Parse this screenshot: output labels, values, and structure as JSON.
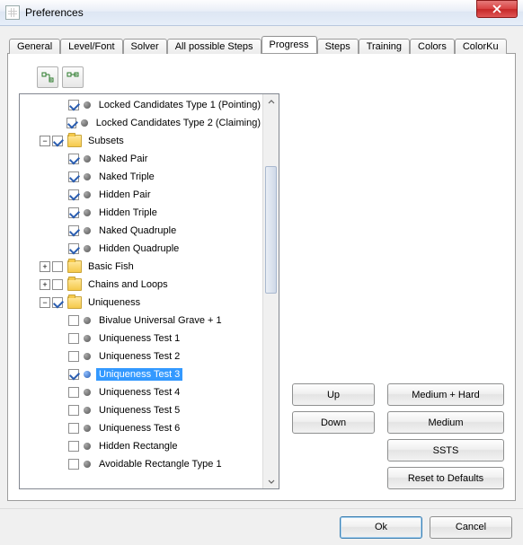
{
  "window": {
    "title": "Preferences"
  },
  "tabs": {
    "items": [
      "General",
      "Level/Font",
      "Solver",
      "All possible Steps",
      "Progress",
      "Steps",
      "Training",
      "Colors",
      "ColorKu"
    ],
    "active_index": 4
  },
  "toolbar": {
    "expand_all_name": "expand-all",
    "collapse_all_name": "collapse-all"
  },
  "tree": {
    "selected_label": "Uniqueness Test 3",
    "rows": [
      {
        "depth": 2,
        "expander": "",
        "checked": true,
        "icon": "bullet",
        "label": "Locked Candidates Type 1 (Pointing)"
      },
      {
        "depth": 2,
        "expander": "",
        "checked": true,
        "icon": "bullet",
        "label": "Locked Candidates Type 2 (Claiming)"
      },
      {
        "depth": 1,
        "expander": "-",
        "checked": true,
        "icon": "folder",
        "label": "Subsets"
      },
      {
        "depth": 2,
        "expander": "",
        "checked": true,
        "icon": "bullet",
        "label": "Naked Pair"
      },
      {
        "depth": 2,
        "expander": "",
        "checked": true,
        "icon": "bullet",
        "label": "Naked Triple"
      },
      {
        "depth": 2,
        "expander": "",
        "checked": true,
        "icon": "bullet",
        "label": "Hidden Pair"
      },
      {
        "depth": 2,
        "expander": "",
        "checked": true,
        "icon": "bullet",
        "label": "Hidden Triple"
      },
      {
        "depth": 2,
        "expander": "",
        "checked": true,
        "icon": "bullet",
        "label": "Naked Quadruple"
      },
      {
        "depth": 2,
        "expander": "",
        "checked": true,
        "icon": "bullet",
        "label": "Hidden Quadruple"
      },
      {
        "depth": 1,
        "expander": "+",
        "checked": false,
        "icon": "folder",
        "label": "Basic Fish"
      },
      {
        "depth": 1,
        "expander": "+",
        "checked": false,
        "icon": "folder",
        "label": "Chains and Loops"
      },
      {
        "depth": 1,
        "expander": "-",
        "checked": true,
        "icon": "folder",
        "label": "Uniqueness"
      },
      {
        "depth": 2,
        "expander": "",
        "checked": false,
        "icon": "bullet",
        "label": "Bivalue Universal Grave + 1"
      },
      {
        "depth": 2,
        "expander": "",
        "checked": false,
        "icon": "bullet",
        "label": "Uniqueness Test 1"
      },
      {
        "depth": 2,
        "expander": "",
        "checked": false,
        "icon": "bullet",
        "label": "Uniqueness Test 2"
      },
      {
        "depth": 2,
        "expander": "",
        "checked": true,
        "icon": "bullet",
        "label": "Uniqueness Test 3",
        "selected": true
      },
      {
        "depth": 2,
        "expander": "",
        "checked": false,
        "icon": "bullet",
        "label": "Uniqueness Test 4"
      },
      {
        "depth": 2,
        "expander": "",
        "checked": false,
        "icon": "bullet",
        "label": "Uniqueness Test 5"
      },
      {
        "depth": 2,
        "expander": "",
        "checked": false,
        "icon": "bullet",
        "label": "Uniqueness Test 6"
      },
      {
        "depth": 2,
        "expander": "",
        "checked": false,
        "icon": "bullet",
        "label": "Hidden Rectangle"
      },
      {
        "depth": 2,
        "expander": "",
        "checked": false,
        "icon": "bullet",
        "label": "Avoidable Rectangle Type 1"
      }
    ]
  },
  "buttons": {
    "up": "Up",
    "down": "Down",
    "medium_hard": "Medium + Hard",
    "medium": "Medium",
    "ssts": "SSTS",
    "reset": "Reset to Defaults",
    "ok": "Ok",
    "cancel": "Cancel"
  }
}
